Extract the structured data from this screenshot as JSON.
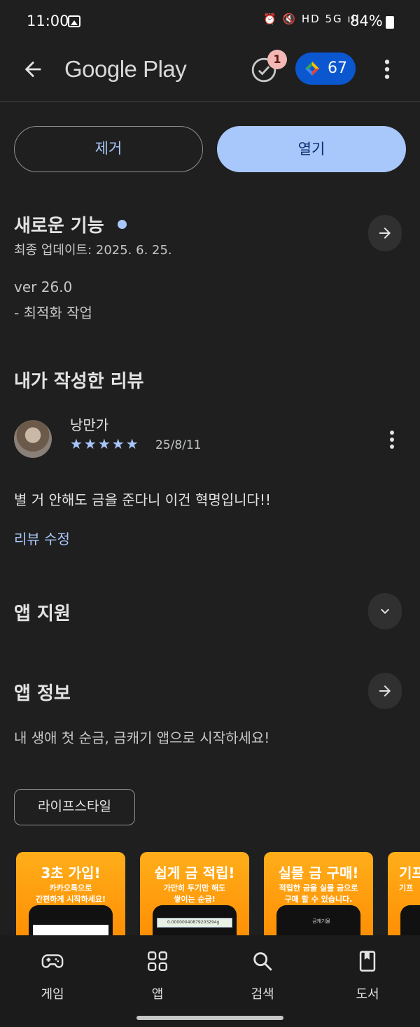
{
  "status_bar": {
    "time": "11:00",
    "indicators": "⏰ 🔇 HD 5G ıll",
    "battery": "84%"
  },
  "header": {
    "brand": "Google Play",
    "tasks_badge": "1",
    "points": "67"
  },
  "actions": {
    "remove_label": "제거",
    "open_label": "열기"
  },
  "whats_new": {
    "title": "새로운 기능",
    "updated": "최종 업데이트: 2025. 6. 25.",
    "version": "ver 26.0",
    "notes": "- 최적화 작업"
  },
  "my_review": {
    "title": "내가 작성한 리뷰",
    "reviewer": "낭만가",
    "stars": "★★★★★",
    "rating": 5,
    "date": "25/8/11",
    "text": "별 거 안해도 금을 준다니 이건 혁명입니다!!",
    "edit_label": "리뷰 수정"
  },
  "app_support": {
    "title": "앱 지원"
  },
  "app_info": {
    "title": "앱 정보",
    "description": "내 생애 첫 순금, 금캐기 앱으로 시작하세요!",
    "category_chip": "라이프스타일"
  },
  "screenshots": [
    {
      "headline": "3초 가입!",
      "line1": "카카오톡으로",
      "line2": "간편하게 시작하세요!"
    },
    {
      "headline": "쉽게 금 적립!",
      "line1": "가만히 두기만 해도",
      "line2": "쌓이는 순금!",
      "phone_text": "0.00000040879203294g"
    },
    {
      "headline": "실물 금 구매!",
      "line1": "적립한 금을 실물 금으로",
      "line2": "구매 할 수 있습니다.",
      "phone_text": "금캐기몰"
    },
    {
      "headline": "기프",
      "line1": "기프",
      "line2": ""
    }
  ],
  "bottom_nav": {
    "games": "게임",
    "apps": "앱",
    "search": "검색",
    "books": "도서"
  },
  "colors": {
    "background": "#1f1f1f",
    "accent": "#a8c7fa",
    "points_pill": "#0b57d0",
    "screenshot_orange": "#ff9a00"
  }
}
